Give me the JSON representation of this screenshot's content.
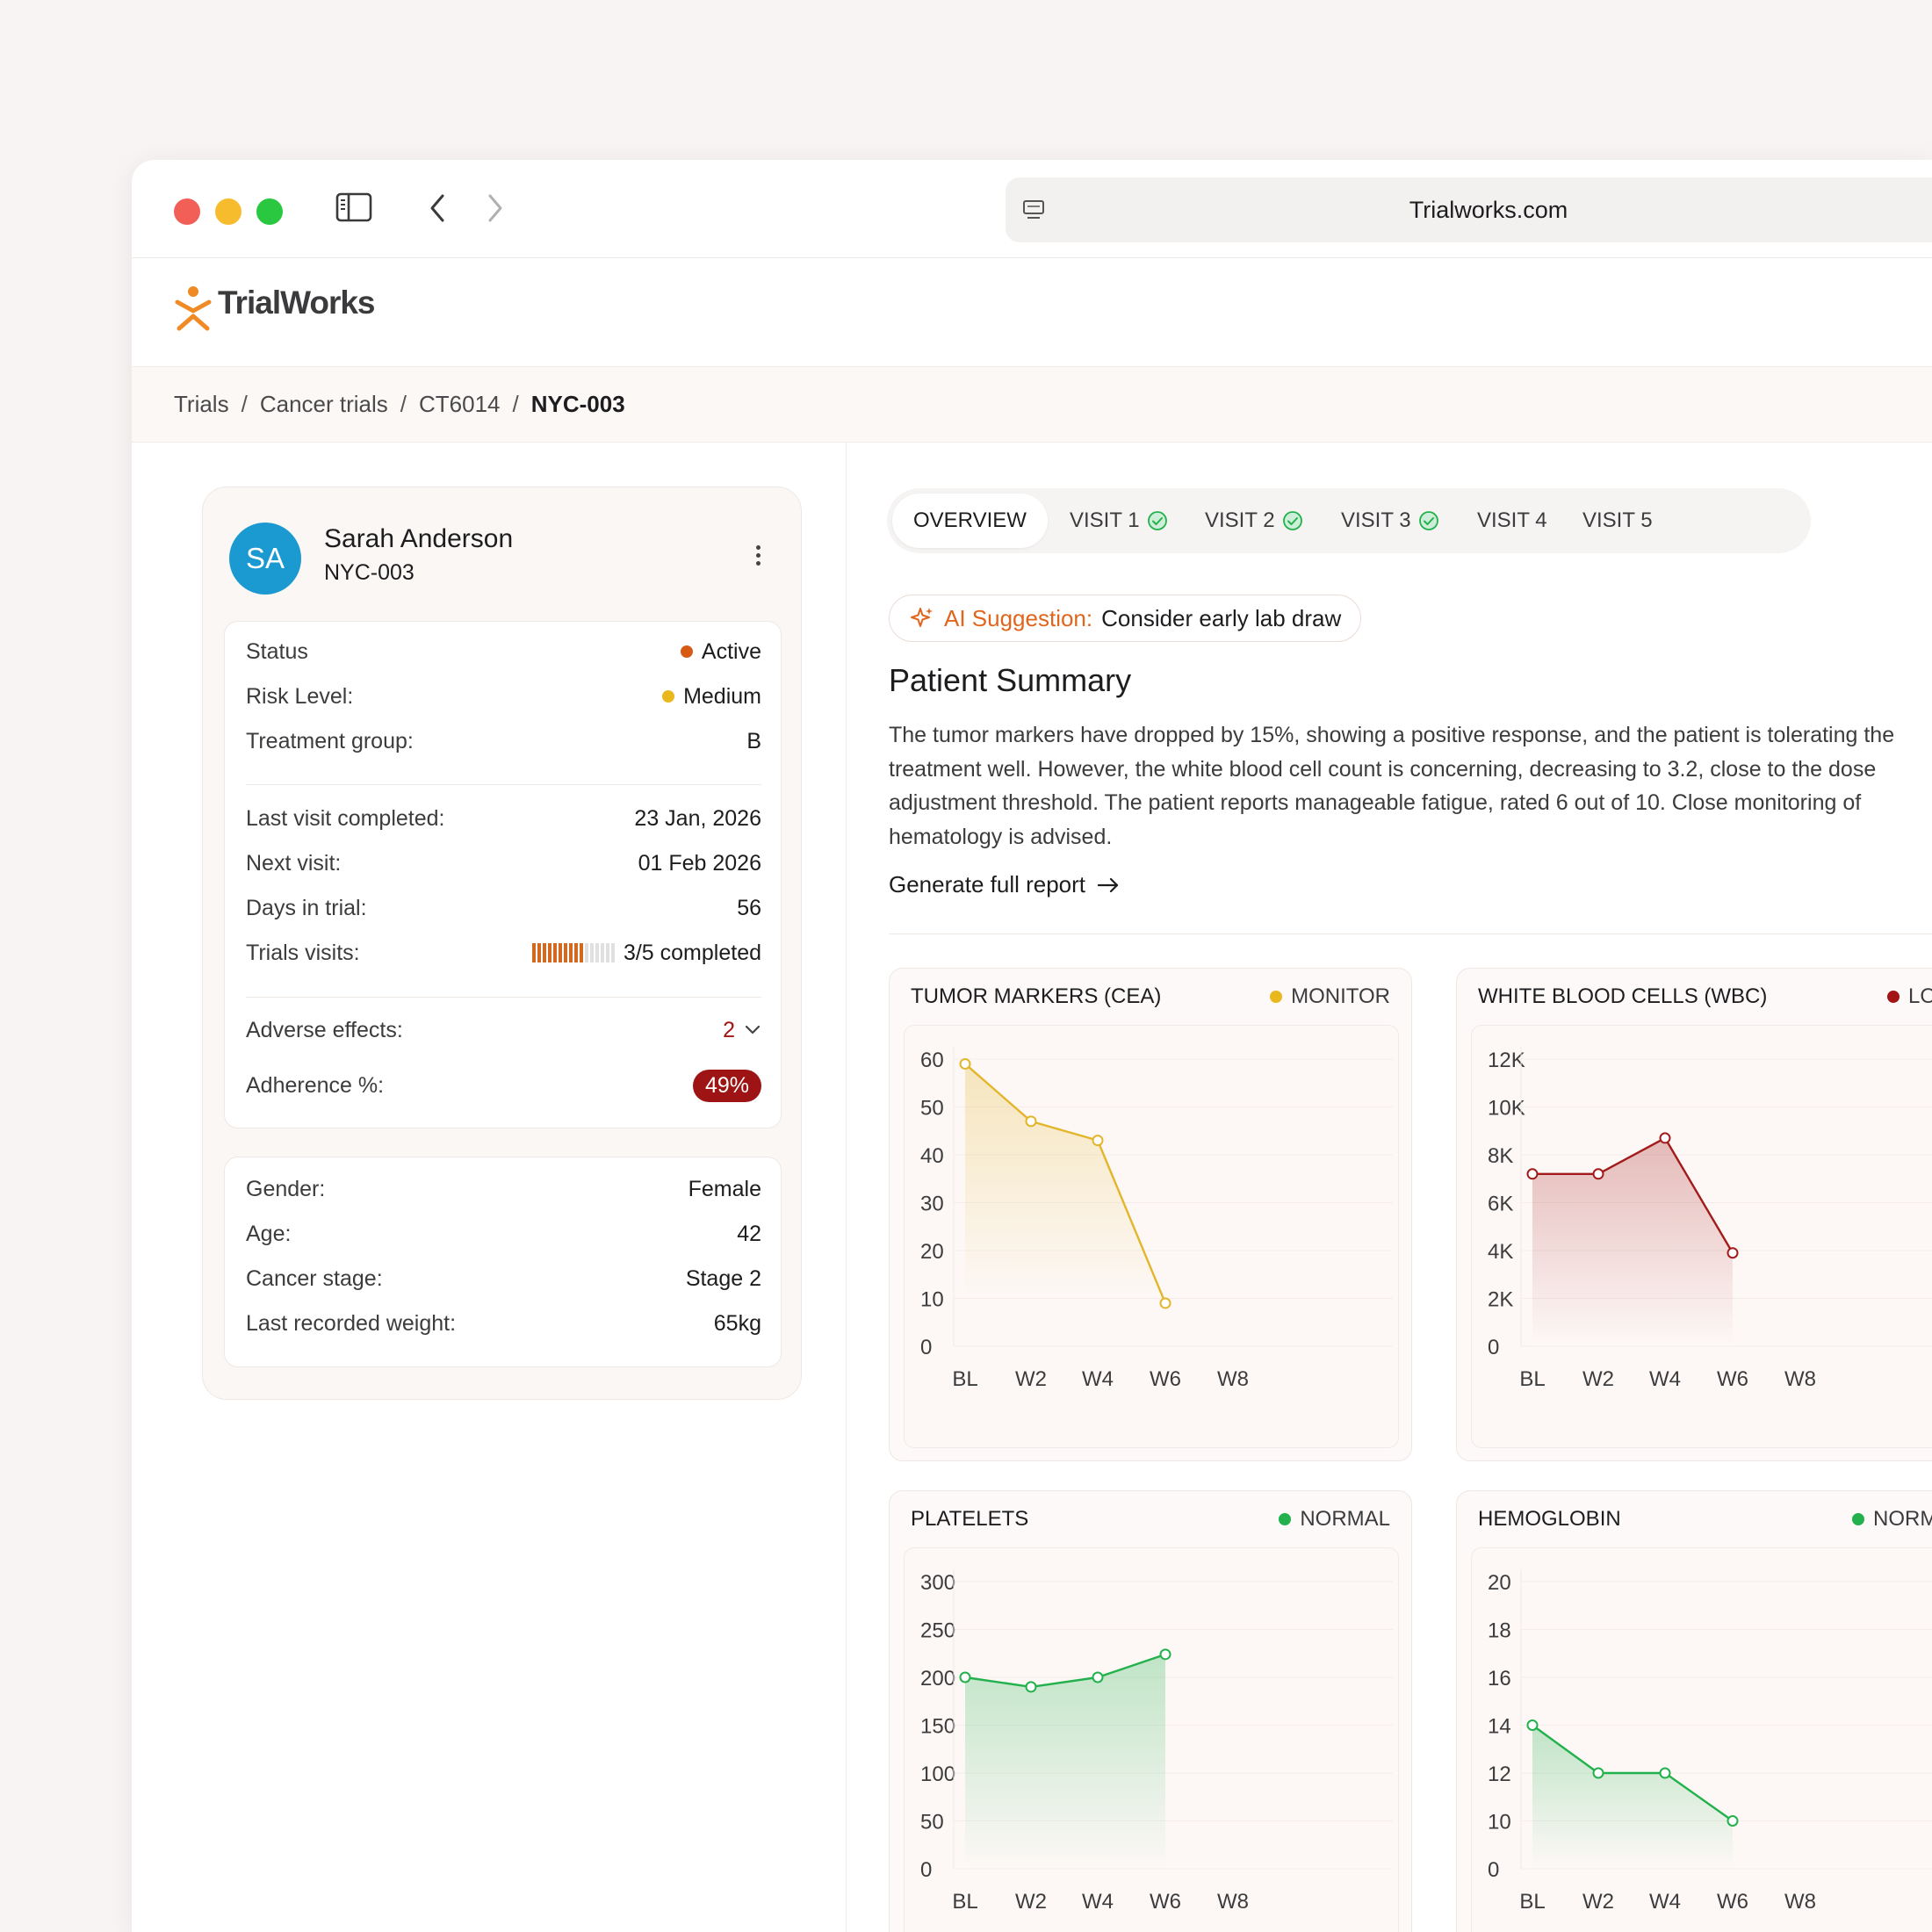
{
  "browser": {
    "url": "Trialworks.com"
  },
  "app": {
    "logo_text": "TrialWorks",
    "brand_color": "#f08a24"
  },
  "breadcrumb": [
    "Trials",
    "Cancer trials",
    "CT6014",
    "NYC-003"
  ],
  "patient": {
    "initials": "SA",
    "name": "Sarah Anderson",
    "id": "NYC-003",
    "status": {
      "label": "Status",
      "value": "Active",
      "color": "#d65a14"
    },
    "risk": {
      "label": "Risk Level:",
      "value": "Medium",
      "color": "#e8b81d"
    },
    "treatment_group": {
      "label": "Treatment group:",
      "value": "B"
    },
    "last_visit": {
      "label": "Last visit completed:",
      "value": "23 Jan, 2026"
    },
    "next_visit": {
      "label": "Next visit:",
      "value": "01 Feb 2026"
    },
    "days_in_trial": {
      "label": "Days in trial:",
      "value": "56"
    },
    "trial_visits": {
      "label": "Trials visits:",
      "value": "3/5 completed",
      "completed": 3,
      "total": 5,
      "progress_fraction": 0.6
    },
    "adverse_effects": {
      "label": "Adverse effects:",
      "value": "2"
    },
    "adherence": {
      "label": "Adherence %:",
      "value": "49%"
    },
    "gender": {
      "label": "Gender:",
      "value": "Female"
    },
    "age": {
      "label": "Age:",
      "value": "42"
    },
    "cancer_stage": {
      "label": "Cancer stage:",
      "value": "Stage 2"
    },
    "weight": {
      "label": "Last recorded weight:",
      "value": "65kg"
    }
  },
  "tabs": [
    {
      "label": "OVERVIEW",
      "active": true
    },
    {
      "label": "VISIT 1",
      "done": true
    },
    {
      "label": "VISIT 2",
      "done": true
    },
    {
      "label": "VISIT 3",
      "done": true
    },
    {
      "label": "VISIT 4",
      "done": false
    },
    {
      "label": "VISIT 5",
      "done": false
    }
  ],
  "ai": {
    "label": "AI Suggestion:",
    "text": "Consider early lab draw"
  },
  "summary": {
    "title": "Patient Summary",
    "text": "The tumor markers have dropped by 15%, showing a positive response, and the patient is tolerating the treatment well. However, the white blood cell count is concerning, decreasing to 3.2, close to the dose adjustment threshold. The patient reports manageable fatigue, rated 6 out of 10. Close monitoring of hematology is advised.",
    "link": "Generate full report"
  },
  "chart_data": [
    {
      "type": "area",
      "title": "TUMOR MARKERS (CEA)",
      "status": "MONITOR",
      "status_color": "#e8b81d",
      "color": "#e3b52a",
      "categories": [
        "BL",
        "W2",
        "W4",
        "W6",
        "W8"
      ],
      "y_ticks": [
        "60",
        "50",
        "40",
        "30",
        "20",
        "10",
        "0"
      ],
      "ylim": [
        0,
        60
      ],
      "values": [
        59,
        47,
        43,
        9
      ]
    },
    {
      "type": "area",
      "title": "WHITE BLOOD CELLS (WBC)",
      "status": "LOW",
      "status_color": "#a31515",
      "color": "#a31a1a",
      "categories": [
        "BL",
        "W2",
        "W4",
        "W6",
        "W8"
      ],
      "y_ticks": [
        "12K",
        "10K",
        "8K",
        "6K",
        "4K",
        "2K",
        "0"
      ],
      "ylim": [
        0,
        12000
      ],
      "values": [
        7200,
        7200,
        8700,
        3900
      ]
    },
    {
      "type": "area",
      "title": "PLATELETS",
      "status": "NORMAL",
      "status_color": "#22b14c",
      "color": "#22b14c",
      "categories": [
        "BL",
        "W2",
        "W4",
        "W6",
        "W8"
      ],
      "y_ticks": [
        "300",
        "250",
        "200",
        "150",
        "100",
        "50",
        "0"
      ],
      "ylim": [
        0,
        300
      ],
      "values": [
        200,
        190,
        200,
        224
      ]
    },
    {
      "type": "area",
      "title": "HEMOGLOBIN",
      "status": "NORMAL",
      "status_color": "#22b14c",
      "color": "#22b14c",
      "categories": [
        "BL",
        "W2",
        "W4",
        "W6",
        "W8"
      ],
      "y_ticks": [
        "20",
        "18",
        "16",
        "14",
        "12",
        "10",
        "0"
      ],
      "ylim": [
        0,
        20
      ],
      "values": [
        14,
        12,
        12,
        10
      ]
    }
  ]
}
